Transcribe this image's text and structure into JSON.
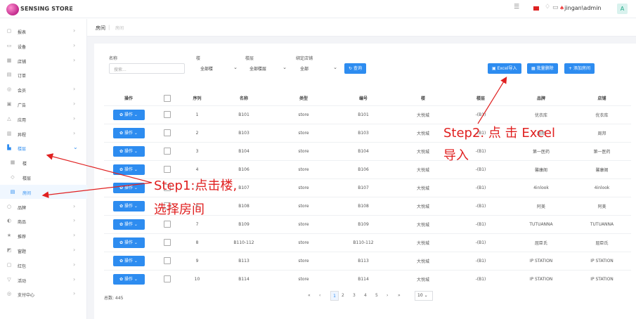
{
  "header": {
    "brand": "SENSING STORE",
    "collapse_icon": "chevron-left",
    "user": "jingan\\admin",
    "avatar": "A"
  },
  "sidebar": [
    {
      "label": "报表",
      "icon": "▢"
    },
    {
      "label": "设备",
      "icon": "▭"
    },
    {
      "label": "店铺",
      "icon": "▦"
    },
    {
      "label": "订单",
      "icon": "▤"
    },
    {
      "label": "会员",
      "icon": "◎"
    },
    {
      "label": "广告",
      "icon": "▣"
    },
    {
      "label": "应用",
      "icon": "△"
    },
    {
      "label": "异程",
      "icon": "▥"
    },
    {
      "label": "楼层",
      "icon": "▙"
    },
    {
      "label": "楼",
      "icon": "▦"
    },
    {
      "label": "楼层",
      "icon": "◇"
    },
    {
      "label": "房间",
      "icon": "▤"
    },
    {
      "label": "品牌",
      "icon": "○"
    },
    {
      "label": "商品",
      "icon": "◐"
    },
    {
      "label": "推荐",
      "icon": "★"
    },
    {
      "label": "窗题",
      "icon": "◩"
    },
    {
      "label": "红包",
      "icon": "▢"
    },
    {
      "label": "活动",
      "icon": "▽"
    },
    {
      "label": "支付中心",
      "icon": "◎"
    }
  ],
  "tabs": {
    "current": "房间",
    "sub": "房间"
  },
  "filters": {
    "name_label": "名称",
    "name_placeholder": "搜索...",
    "building_label": "楼",
    "building_value": "全部楼",
    "floor_label": "楼层",
    "floor_value": "全部楼层",
    "store_label": "绑定店铺",
    "store_value": "全部",
    "search_button": "查询"
  },
  "actions": {
    "excel_import": "Excel导入",
    "batch_delete": "批量删除",
    "add_room": "添加房间"
  },
  "table": {
    "headers": [
      "操作",
      "",
      "序列",
      "名称",
      "类型",
      "编号",
      "楼",
      "楼层",
      "品牌",
      "店铺"
    ],
    "op_label": "操作",
    "rows": [
      [
        "1",
        "B101",
        "store",
        "B101",
        "大悦城",
        "-(B1)",
        "优衣库",
        "优衣库"
      ],
      [
        "2",
        "B103",
        "store",
        "B103",
        "大悦城",
        "-(B1)",
        "周邦",
        "周邦"
      ],
      [
        "3",
        "B104",
        "store",
        "B104",
        "大悦城",
        "-(B1)",
        "第一医药",
        "第一医药"
      ],
      [
        "4",
        "B106",
        "store",
        "B106",
        "大悦城",
        "-(B1)",
        "馨康阁",
        "馨康阁"
      ],
      [
        "5",
        "B107",
        "store",
        "B107",
        "大悦城",
        "-(B1)",
        "4inlook",
        "4inlook"
      ],
      [
        "6",
        "B108",
        "store",
        "B108",
        "大悦城",
        "-(B1)",
        "阿美",
        "阿美"
      ],
      [
        "7",
        "B109",
        "store",
        "B109",
        "大悦城",
        "-(B1)",
        "TUTUANNA",
        "TUTUANNA"
      ],
      [
        "8",
        "B110-112",
        "store",
        "B110-112",
        "大悦城",
        "-(B1)",
        "屈臣氏",
        "屈臣氏"
      ],
      [
        "9",
        "B113",
        "store",
        "B113",
        "大悦城",
        "-(B1)",
        "IP STATION",
        "IP STATION"
      ],
      [
        "10",
        "B114",
        "store",
        "B114",
        "大悦城",
        "-(B1)",
        "IP STATION",
        "IP STATION"
      ]
    ]
  },
  "footer": {
    "total": "总数: 445",
    "pages": [
      "«",
      "‹",
      "1",
      "2",
      "3",
      "4",
      "5",
      "›",
      "»"
    ],
    "page_size": "10"
  },
  "annotations": {
    "step1_line1": "Step1:点击楼,",
    "step1_line2": "选择房间",
    "step2_line1": "Step2. 点 击 Excel",
    "step2_line2": "导入"
  },
  "colors": {
    "primary": "#2d8cf0",
    "annotation": "#e02020"
  }
}
